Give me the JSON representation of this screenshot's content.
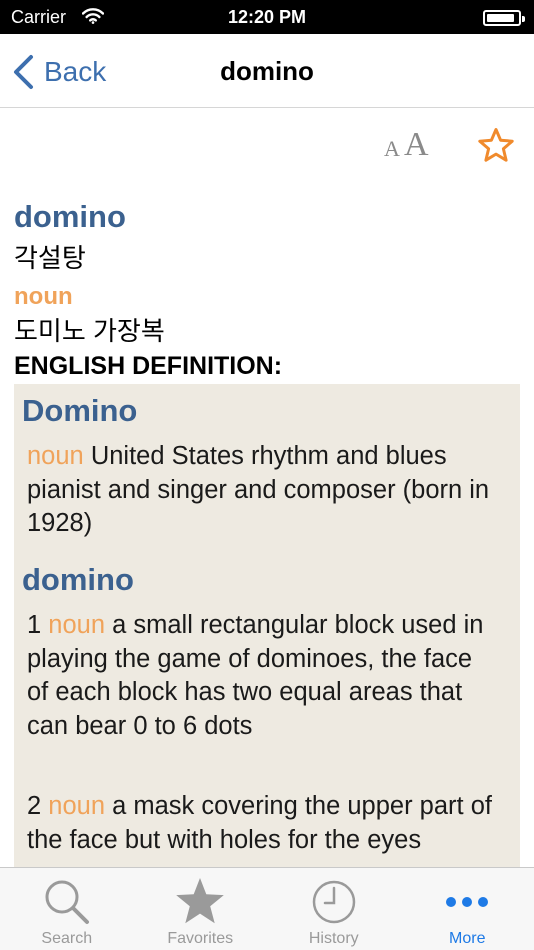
{
  "status_bar": {
    "carrier": "Carrier",
    "time": "12:20 PM",
    "battery_level": 0.9
  },
  "nav": {
    "back_label": "Back",
    "title": "domino"
  },
  "toolbar": {
    "font_size_small": "A",
    "font_size_large": "A",
    "favorite_icon": "star-outline-icon"
  },
  "entry": {
    "headword": "domino",
    "translation": "각설탕",
    "part_of_speech": "noun",
    "pos_translation": "도미노 가장복",
    "section_header": "ENGLISH DEFINITION:"
  },
  "definitions": [
    {
      "entry": "Domino",
      "senses": [
        {
          "number": "",
          "pos": "noun",
          "text": " United States rhythm and blues pianist and singer and composer (born in 1928)"
        }
      ]
    },
    {
      "entry": "domino",
      "senses": [
        {
          "number": "1 ",
          "pos": "noun",
          "text": " a small rectangular block used in playing the game of dominoes, the face of each block has two equal areas that can bear 0 to 6 dots"
        },
        {
          "number": "2 ",
          "pos": "noun",
          "text": " a mask covering the upper part of the face but with holes for the eyes"
        }
      ]
    }
  ],
  "tabbar": {
    "active": "More",
    "tabs": [
      {
        "label": "Search",
        "icon": "search-icon"
      },
      {
        "label": "Favorites",
        "icon": "star-icon"
      },
      {
        "label": "History",
        "icon": "clock-icon"
      },
      {
        "label": "More",
        "icon": "more-icon"
      }
    ]
  },
  "colors": {
    "accent_blue": "#3d6fae",
    "headword_blue": "#3b618f",
    "pos_orange": "#f0a35a",
    "star_orange": "#f08a2c",
    "definition_background": "#eeeae1",
    "tab_active": "#1e7ae6",
    "tab_inactive": "#9a9a9a"
  }
}
